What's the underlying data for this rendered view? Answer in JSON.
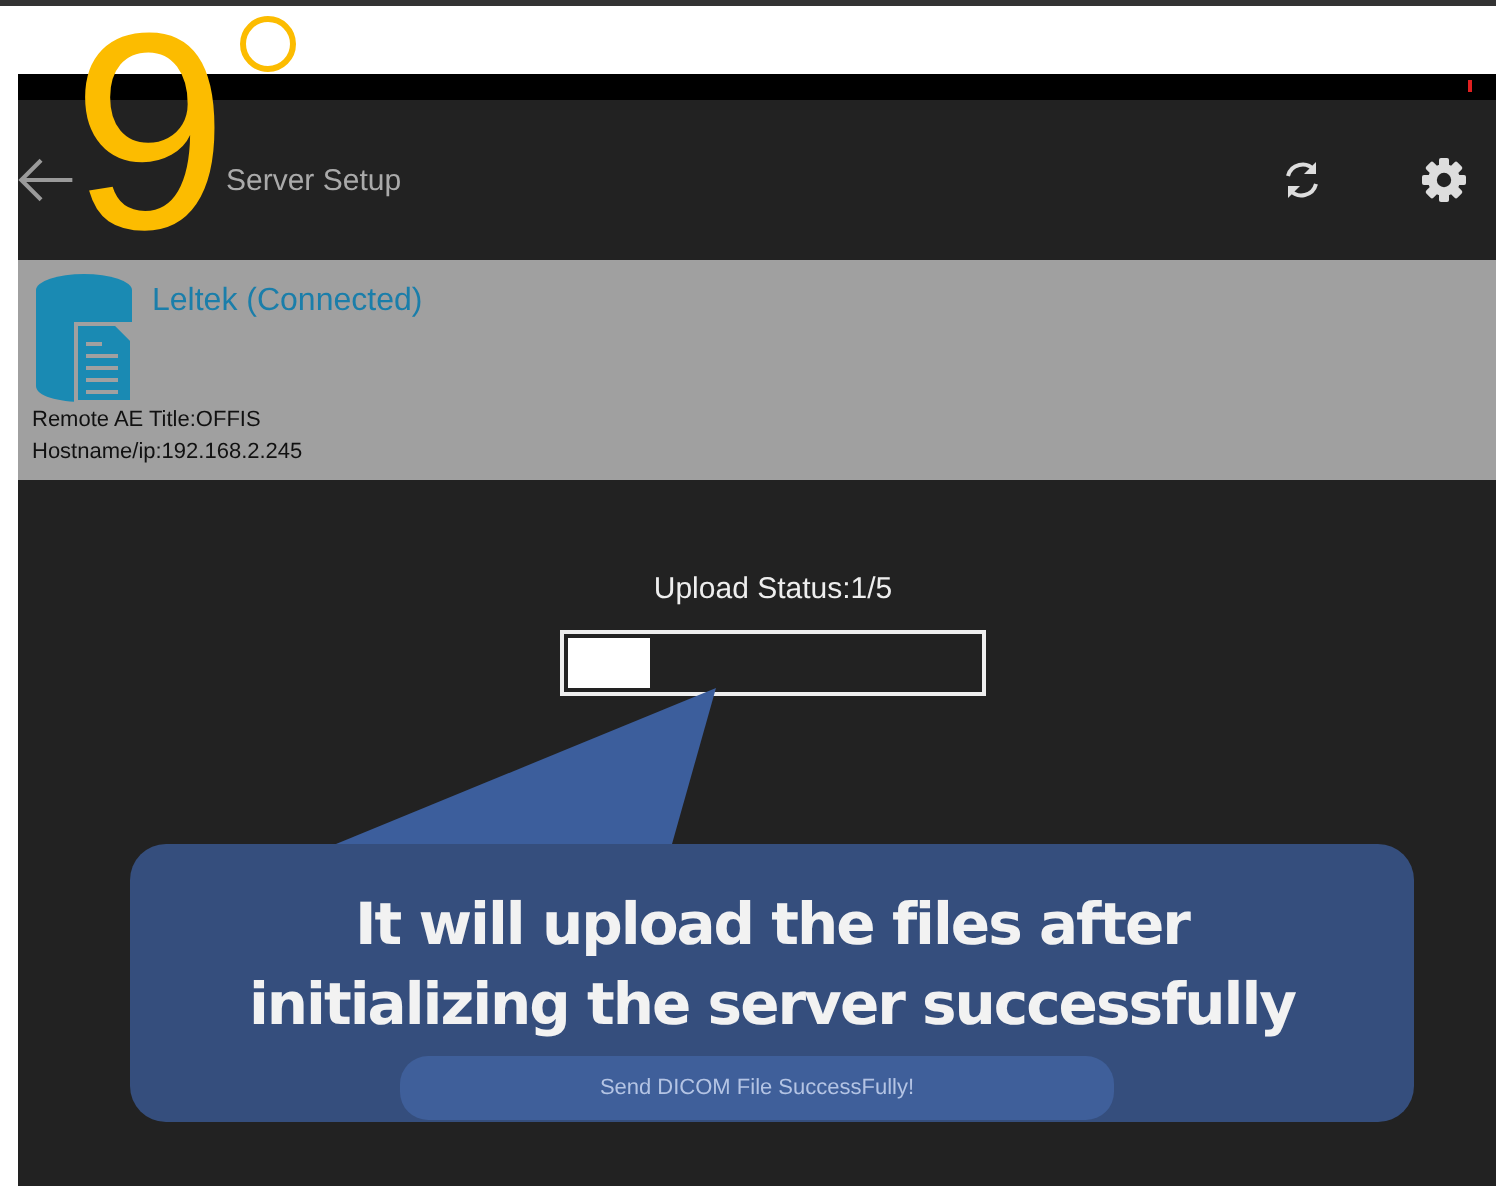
{
  "step_marker": {
    "number": "9"
  },
  "app_bar": {
    "title": "Server Setup"
  },
  "server": {
    "name": "Leltek (Connected)",
    "details": [
      "Remote AE Title:OFFIS",
      "Hostname/ip:192.168.2.245"
    ]
  },
  "upload": {
    "label": "Upload Status:1/5",
    "level": 0.2
  },
  "toast": {
    "text": "Send DICOM File SuccessFully!"
  },
  "callout": {
    "lines": [
      "It will upload the files after",
      "initializing the server successfully"
    ]
  }
}
